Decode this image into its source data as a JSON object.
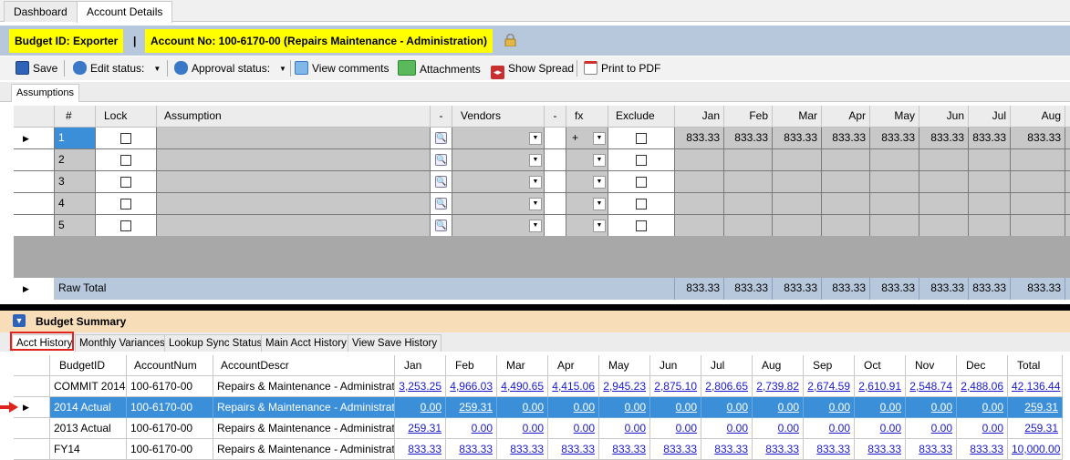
{
  "tabs": [
    "Dashboard",
    "Account Details"
  ],
  "header": {
    "budget_id": "Budget ID: Exporter",
    "separator": "|",
    "account_no": "Account No: 100-6170-00 (Repairs  Maintenance - Administration)"
  },
  "toolbar": {
    "save": "Save",
    "edit_status": "Edit status:",
    "approval_status": "Approval status:",
    "view_comments": "View comments",
    "attachments": "Attachments",
    "show_spread": "Show Spread",
    "print_pdf": "Print to PDF"
  },
  "assumptions_tab": "Assumptions",
  "grid": {
    "headers": [
      "#",
      "Lock",
      "Assumption",
      "-",
      "Vendors",
      "-",
      "fx",
      "Exclude",
      "Jan",
      "Feb",
      "Mar",
      "Apr",
      "May",
      "Jun",
      "Jul",
      "Aug"
    ],
    "rows": [
      {
        "num": "1",
        "fx": "+",
        "months": [
          "833.33",
          "833.33",
          "833.33",
          "833.33",
          "833.33",
          "833.33",
          "833.33",
          "833.33"
        ]
      },
      {
        "num": "2",
        "fx": "",
        "months": [
          "",
          "",
          "",
          "",
          "",
          "",
          "",
          ""
        ]
      },
      {
        "num": "3",
        "fx": "",
        "months": [
          "",
          "",
          "",
          "",
          "",
          "",
          "",
          ""
        ]
      },
      {
        "num": "4",
        "fx": "",
        "months": [
          "",
          "",
          "",
          "",
          "",
          "",
          "",
          ""
        ]
      },
      {
        "num": "5",
        "fx": "",
        "months": [
          "",
          "",
          "",
          "",
          "",
          "",
          "",
          ""
        ]
      }
    ],
    "raw_total_label": "Raw Total",
    "raw_total": [
      "833.33",
      "833.33",
      "833.33",
      "833.33",
      "833.33",
      "833.33",
      "833.33",
      "833.33"
    ]
  },
  "budget_summary": {
    "title": "Budget Summary",
    "tabs": [
      "Acct History",
      "Monthly Variances",
      "Lookup Sync Status",
      "Main Acct History",
      "View Save History"
    ],
    "headers": [
      "BudgetID",
      "AccountNum",
      "AccountDescr",
      "Jan",
      "Feb",
      "Mar",
      "Apr",
      "May",
      "Jun",
      "Jul",
      "Aug",
      "Sep",
      "Oct",
      "Nov",
      "Dec",
      "Total"
    ],
    "rows": [
      [
        "COMMIT 2014",
        "100-6170-00",
        "Repairs & Maintenance - Administration",
        "3,253.25",
        "4,966.03",
        "4,490.65",
        "4,415.06",
        "2,945.23",
        "2,875.10",
        "2,806.65",
        "2,739.82",
        "2,674.59",
        "2,610.91",
        "2,548.74",
        "2,488.06",
        "42,136.44"
      ],
      [
        "2014 Actual",
        "100-6170-00",
        "Repairs & Maintenance - Administration",
        "0.00",
        "259.31",
        "0.00",
        "0.00",
        "0.00",
        "0.00",
        "0.00",
        "0.00",
        "0.00",
        "0.00",
        "0.00",
        "0.00",
        "259.31"
      ],
      [
        "2013 Actual",
        "100-6170-00",
        "Repairs & Maintenance - Administration",
        "259.31",
        "0.00",
        "0.00",
        "0.00",
        "0.00",
        "0.00",
        "0.00",
        "0.00",
        "0.00",
        "0.00",
        "0.00",
        "0.00",
        "259.31"
      ],
      [
        "FY14",
        "100-6170-00",
        "Repairs & Maintenance - Administration",
        "833.33",
        "833.33",
        "833.33",
        "833.33",
        "833.33",
        "833.33",
        "833.33",
        "833.33",
        "833.33",
        "833.33",
        "833.33",
        "833.33",
        "10,000.00"
      ]
    ],
    "selected_row": 1
  },
  "colors": {
    "header_bg": "#b8c8dc",
    "highlight": "#ffff00",
    "selection": "#3b8fd9",
    "annotation": "#e0241c"
  }
}
